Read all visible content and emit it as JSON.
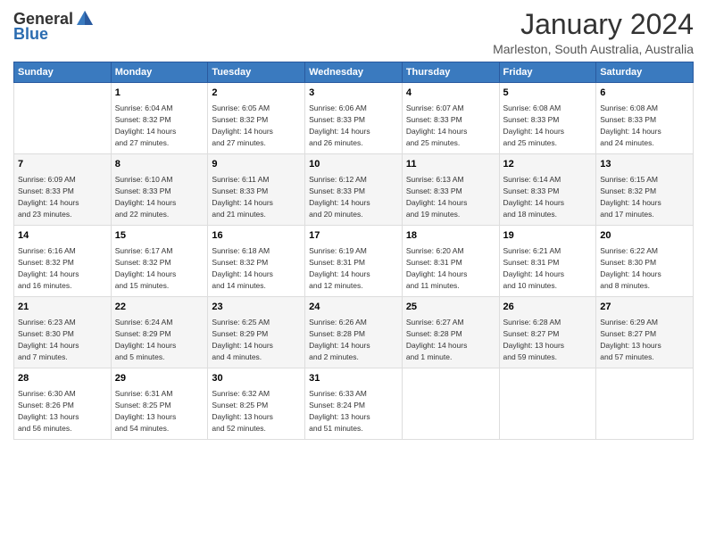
{
  "header": {
    "logo_general": "General",
    "logo_blue": "Blue",
    "title": "January 2024",
    "subtitle": "Marleston, South Australia, Australia"
  },
  "days_of_week": [
    "Sunday",
    "Monday",
    "Tuesday",
    "Wednesday",
    "Thursday",
    "Friday",
    "Saturday"
  ],
  "weeks": [
    [
      {
        "day": "",
        "info": ""
      },
      {
        "day": "1",
        "info": "Sunrise: 6:04 AM\nSunset: 8:32 PM\nDaylight: 14 hours\nand 27 minutes."
      },
      {
        "day": "2",
        "info": "Sunrise: 6:05 AM\nSunset: 8:32 PM\nDaylight: 14 hours\nand 27 minutes."
      },
      {
        "day": "3",
        "info": "Sunrise: 6:06 AM\nSunset: 8:33 PM\nDaylight: 14 hours\nand 26 minutes."
      },
      {
        "day": "4",
        "info": "Sunrise: 6:07 AM\nSunset: 8:33 PM\nDaylight: 14 hours\nand 25 minutes."
      },
      {
        "day": "5",
        "info": "Sunrise: 6:08 AM\nSunset: 8:33 PM\nDaylight: 14 hours\nand 25 minutes."
      },
      {
        "day": "6",
        "info": "Sunrise: 6:08 AM\nSunset: 8:33 PM\nDaylight: 14 hours\nand 24 minutes."
      }
    ],
    [
      {
        "day": "7",
        "info": "Sunrise: 6:09 AM\nSunset: 8:33 PM\nDaylight: 14 hours\nand 23 minutes."
      },
      {
        "day": "8",
        "info": "Sunrise: 6:10 AM\nSunset: 8:33 PM\nDaylight: 14 hours\nand 22 minutes."
      },
      {
        "day": "9",
        "info": "Sunrise: 6:11 AM\nSunset: 8:33 PM\nDaylight: 14 hours\nand 21 minutes."
      },
      {
        "day": "10",
        "info": "Sunrise: 6:12 AM\nSunset: 8:33 PM\nDaylight: 14 hours\nand 20 minutes."
      },
      {
        "day": "11",
        "info": "Sunrise: 6:13 AM\nSunset: 8:33 PM\nDaylight: 14 hours\nand 19 minutes."
      },
      {
        "day": "12",
        "info": "Sunrise: 6:14 AM\nSunset: 8:33 PM\nDaylight: 14 hours\nand 18 minutes."
      },
      {
        "day": "13",
        "info": "Sunrise: 6:15 AM\nSunset: 8:32 PM\nDaylight: 14 hours\nand 17 minutes."
      }
    ],
    [
      {
        "day": "14",
        "info": "Sunrise: 6:16 AM\nSunset: 8:32 PM\nDaylight: 14 hours\nand 16 minutes."
      },
      {
        "day": "15",
        "info": "Sunrise: 6:17 AM\nSunset: 8:32 PM\nDaylight: 14 hours\nand 15 minutes."
      },
      {
        "day": "16",
        "info": "Sunrise: 6:18 AM\nSunset: 8:32 PM\nDaylight: 14 hours\nand 14 minutes."
      },
      {
        "day": "17",
        "info": "Sunrise: 6:19 AM\nSunset: 8:31 PM\nDaylight: 14 hours\nand 12 minutes."
      },
      {
        "day": "18",
        "info": "Sunrise: 6:20 AM\nSunset: 8:31 PM\nDaylight: 14 hours\nand 11 minutes."
      },
      {
        "day": "19",
        "info": "Sunrise: 6:21 AM\nSunset: 8:31 PM\nDaylight: 14 hours\nand 10 minutes."
      },
      {
        "day": "20",
        "info": "Sunrise: 6:22 AM\nSunset: 8:30 PM\nDaylight: 14 hours\nand 8 minutes."
      }
    ],
    [
      {
        "day": "21",
        "info": "Sunrise: 6:23 AM\nSunset: 8:30 PM\nDaylight: 14 hours\nand 7 minutes."
      },
      {
        "day": "22",
        "info": "Sunrise: 6:24 AM\nSunset: 8:29 PM\nDaylight: 14 hours\nand 5 minutes."
      },
      {
        "day": "23",
        "info": "Sunrise: 6:25 AM\nSunset: 8:29 PM\nDaylight: 14 hours\nand 4 minutes."
      },
      {
        "day": "24",
        "info": "Sunrise: 6:26 AM\nSunset: 8:28 PM\nDaylight: 14 hours\nand 2 minutes."
      },
      {
        "day": "25",
        "info": "Sunrise: 6:27 AM\nSunset: 8:28 PM\nDaylight: 14 hours\nand 1 minute."
      },
      {
        "day": "26",
        "info": "Sunrise: 6:28 AM\nSunset: 8:27 PM\nDaylight: 13 hours\nand 59 minutes."
      },
      {
        "day": "27",
        "info": "Sunrise: 6:29 AM\nSunset: 8:27 PM\nDaylight: 13 hours\nand 57 minutes."
      }
    ],
    [
      {
        "day": "28",
        "info": "Sunrise: 6:30 AM\nSunset: 8:26 PM\nDaylight: 13 hours\nand 56 minutes."
      },
      {
        "day": "29",
        "info": "Sunrise: 6:31 AM\nSunset: 8:25 PM\nDaylight: 13 hours\nand 54 minutes."
      },
      {
        "day": "30",
        "info": "Sunrise: 6:32 AM\nSunset: 8:25 PM\nDaylight: 13 hours\nand 52 minutes."
      },
      {
        "day": "31",
        "info": "Sunrise: 6:33 AM\nSunset: 8:24 PM\nDaylight: 13 hours\nand 51 minutes."
      },
      {
        "day": "",
        "info": ""
      },
      {
        "day": "",
        "info": ""
      },
      {
        "day": "",
        "info": ""
      }
    ]
  ]
}
